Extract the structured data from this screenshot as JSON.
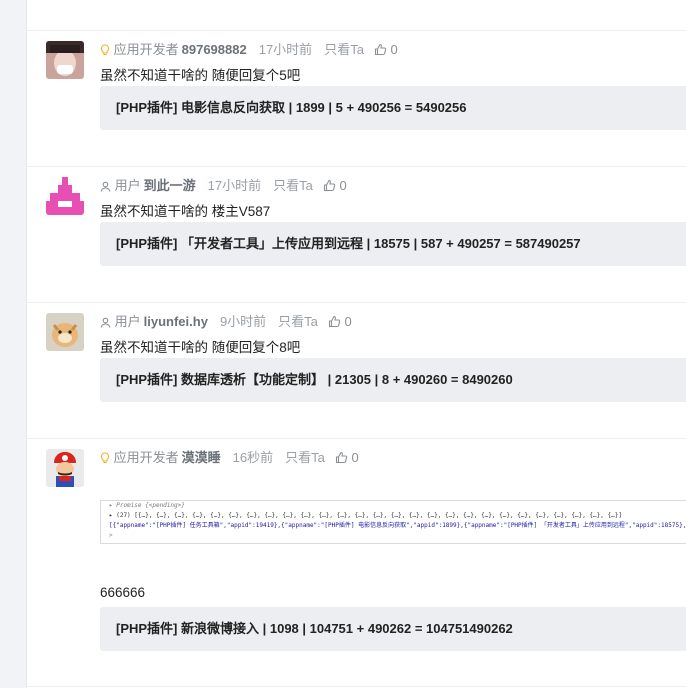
{
  "posts": [
    {
      "role": "应用开发者",
      "role_icon": "lightbulb-icon",
      "username": "897698882",
      "time": "17小时前",
      "only_ta": "只看Ta",
      "likes": "0",
      "content": "虽然不知道干啥的  随便回复个5吧",
      "quote": "[PHP插件] 电影信息反向获取 | 1899 | 5 + 490256 = 5490256"
    },
    {
      "role": "用户",
      "role_icon": "user-icon",
      "username": "到此一游",
      "time": "17小时前",
      "only_ta": "只看Ta",
      "likes": "0",
      "content": "虽然不知道干啥的 楼主V587",
      "quote": "[PHP插件] 「开发者工具」上传应用到远程 | 18575 | 587 + 490257 = 587490257"
    },
    {
      "role": "用户",
      "role_icon": "user-icon",
      "username": "liyunfei.hy",
      "time": "9小时前",
      "only_ta": "只看Ta",
      "likes": "0",
      "content": "虽然不知道干啥的  随便回复个8吧",
      "quote": "[PHP插件] 数据库透析【功能定制】 | 21305 | 8 + 490260 = 8490260"
    },
    {
      "role": "应用开发者",
      "role_icon": "lightbulb-icon",
      "username": "漠漠睡",
      "time": "16秒前",
      "only_ta": "只看Ta",
      "likes": "0",
      "content": "666666",
      "quote": "[PHP插件] 新浪微博接入 | 1098 | 104751 + 490262 = 104751490262"
    }
  ],
  "console": {
    "line1": "▸ Promise {<pending>}",
    "line2": "▸ (27) [{…}, {…}, {…}, {…}, {…}, {…}, {…}, {…}, {…}, {…}, {…}, {…}, {…}, {…}, {…}, {…}, {…}, {…}, {…}, {…}, {…}, {…}, {…}, {…}, {…}, {…}, {…}]",
    "line3": "[{\"appname\":\"[PHP插件]  任务工具箱\",\"appid\":19419},{\"appname\":\"[PHP插件]  电影信息反向获取\",\"appid\":1899},{\"appname\":\"[PHP插件]  「开发者工具」上传应用到远程\",\"appid\":18575},{\"appn",
    "line4": ">"
  }
}
